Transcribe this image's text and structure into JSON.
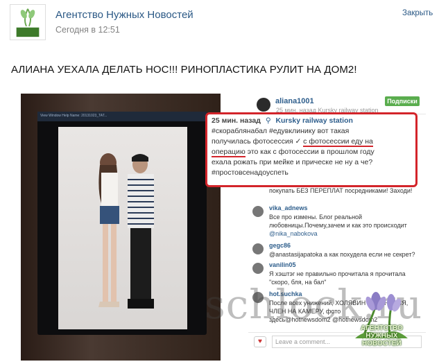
{
  "header": {
    "publisher": "Агентство Нужных Новостей",
    "time": "Сегодня в 12:51",
    "close": "Закрыть",
    "avatar_logo_text": "Агентство Нужных Новостей"
  },
  "post": {
    "title": "АЛИАНА УЕХАЛА ДЕЛАТЬ НОС!!! РИНОПЛАСТИКА РУЛИТ НА ДОМ2!"
  },
  "instagram": {
    "username": "aliana1001",
    "subscribe": "Подписки",
    "faint_meta": "25 мин. назад  Kursky railway station",
    "caption": {
      "time": "25 мин. назад",
      "location": "Kursky railway station",
      "line1": "#скораблянабал #едувклинику вот такая",
      "line2a": "получилась фотосессия ✓",
      "line2b": "с фотосессии еду на",
      "line3a": "операцию",
      "line3b": "это как с фотосессии в прошлом году",
      "line4": "ехала рожать при мейке и прическе  не ну а че? ",
      "line5": " #простовсенадоуспеть"
    },
    "comments": [
      {
        "user": "",
        "body1": "покупать БЕЗ ПЕРЕПЛАТ посредниками! Заходи!",
        "body2": ""
      },
      {
        "user": "vika_adnews",
        "body1": "Все про измены. Блог реальной",
        "body2": "любовницы.Почему,зачем и как это происходит",
        "link": "@nika_nabokova"
      },
      {
        "user": "gegc86",
        "body1": "@anastasijapatoka а как похудела если не секрет?",
        "body2": ""
      },
      {
        "user": "vanilin05",
        "body1": "Я хэштэг не правильно прочитала я прочитала",
        "body2": "\"скоро, бля, на бал\""
      },
      {
        "user": "hot.suchka",
        "body1": "После всех унижений, ХОЛЯВИН ПРИЗНАЛСЯ,",
        "body2": "ЧЛЕН НА КАМЕРУ, фото",
        "body3": "здесь@hotnewsdom2 @hotnewsdom2"
      }
    ],
    "input_placeholder": "Leave a comment...",
    "heart_icon": "heart-icon"
  },
  "monitor": {
    "menu": "View  Window  Help      Name: 20131023_TAT..."
  },
  "overlay": {
    "watermark": "schlock.ru",
    "logo_text_line1": "АГЕНТСТВО",
    "logo_text_line2": "НУЖНЫХ",
    "logo_text_line3": "НОВОСТЕЙ"
  }
}
